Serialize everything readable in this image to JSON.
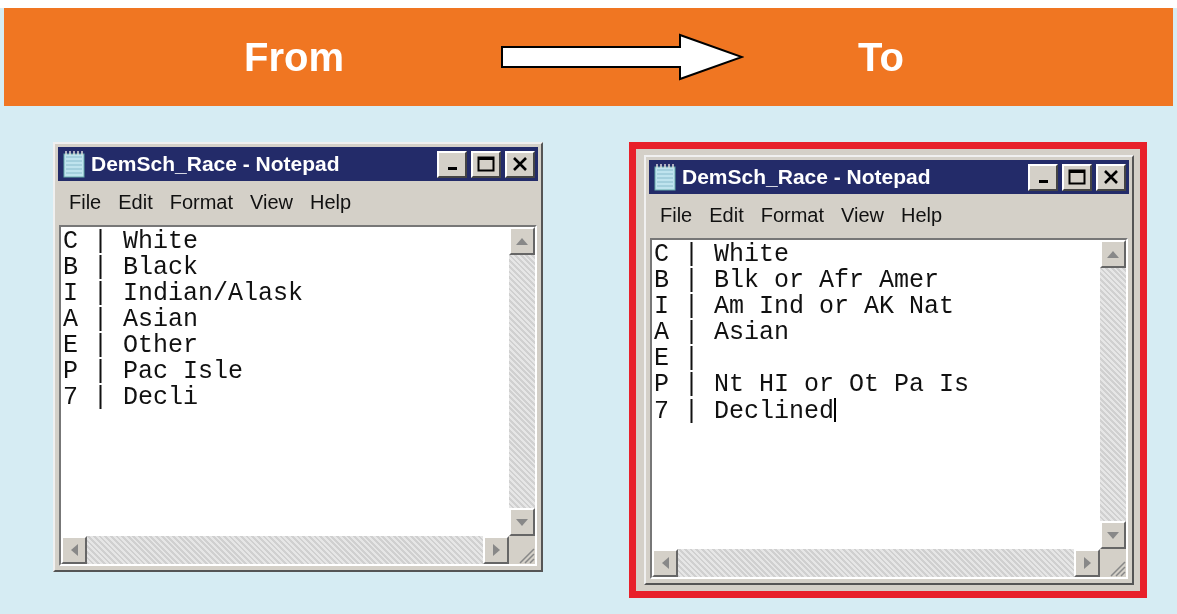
{
  "header": {
    "from_label": "From",
    "to_label": "To"
  },
  "windows": [
    {
      "title": "DemSch_Race - Notepad",
      "highlighted": false,
      "text_cursor": false,
      "menu": [
        "File",
        "Edit",
        "Format",
        "View",
        "Help"
      ],
      "lines": [
        "C | White",
        "B | Black",
        "I | Indian/Alask",
        "A | Asian",
        "E | Other",
        "P | Pac Isle",
        "7 | Decli"
      ]
    },
    {
      "title": "DemSch_Race - Notepad",
      "highlighted": true,
      "text_cursor": true,
      "menu": [
        "File",
        "Edit",
        "Format",
        "View",
        "Help"
      ],
      "lines": [
        "C | White",
        "B | Blk or Afr Amer",
        "I | Am Ind or AK Nat",
        "A | Asian",
        "E |",
        "P | Nt HI or Ot Pa Is",
        "7 | Declined"
      ]
    }
  ]
}
